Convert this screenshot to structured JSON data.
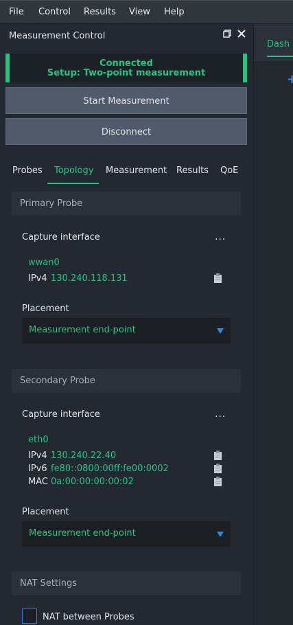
{
  "menubar": {
    "items": [
      "File",
      "Control",
      "Results",
      "View",
      "Help"
    ]
  },
  "panel": {
    "title": "Measurement Control",
    "status": {
      "line1": "Connected",
      "line2": "Setup: Two-point measurement",
      "color": "#27c383"
    },
    "buttons": {
      "start": "Start Measurement",
      "disconnect": "Disconnect"
    },
    "tabs": [
      "Probes",
      "Topology",
      "Measurement",
      "Results",
      "QoE"
    ],
    "active_tab": "Topology",
    "primary": {
      "header": "Primary Probe",
      "capture_label": "Capture interface",
      "more": "...",
      "interface": "wwan0",
      "ipv4_label": "IPv4",
      "ipv4": "130.240.118.131",
      "placement_label": "Placement",
      "placement": "Measurement end-point"
    },
    "secondary": {
      "header": "Secondary Probe",
      "capture_label": "Capture interface",
      "more": "...",
      "interface": "eth0",
      "ipv4_label": "IPv4",
      "ipv4": "130.240.22.40",
      "ipv6_label": "IPv6",
      "ipv6": "fe80::0800:00ff:fe00:0002",
      "mac_label": "MAC",
      "mac": "0a:00:00:00:00:02",
      "placement_label": "Placement",
      "placement": "Measurement end-point"
    },
    "nat": {
      "header": "NAT Settings",
      "checkbox_label": "NAT between Probes",
      "checked": false
    }
  },
  "right_pane": {
    "tab_label": "Dash"
  },
  "colors": {
    "accent": "#27c383",
    "arrow": "#2f8ce6",
    "button": "#4f5b6b"
  }
}
